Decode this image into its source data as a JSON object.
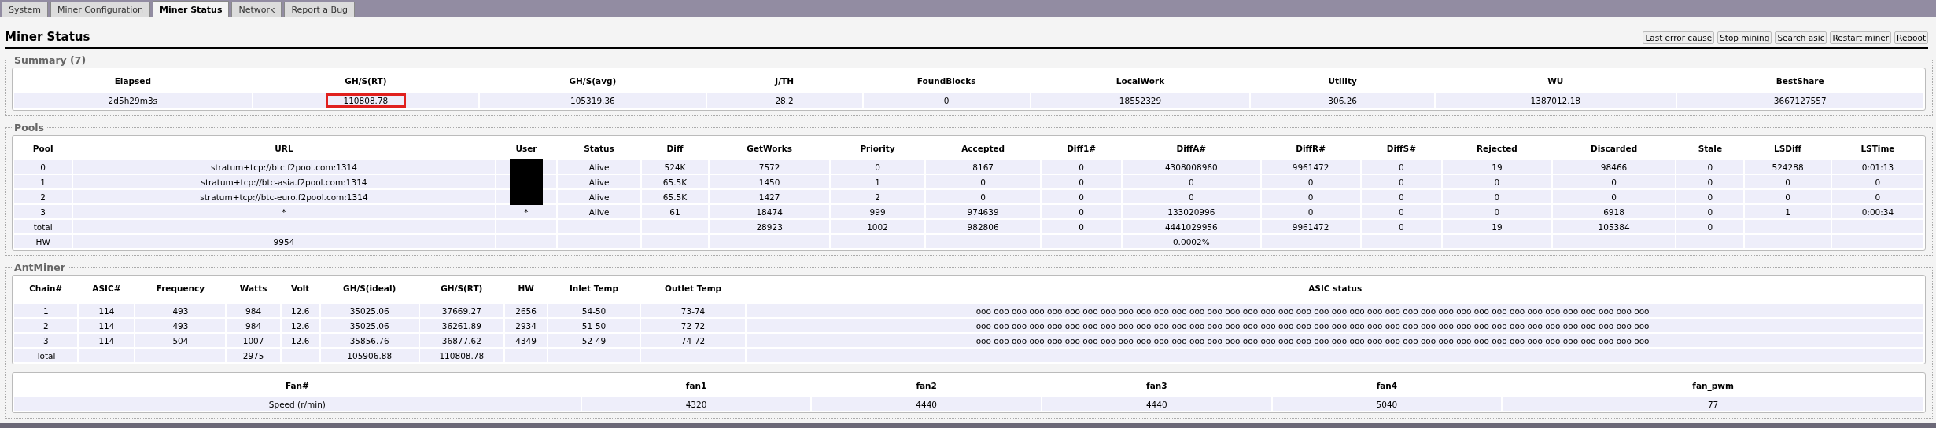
{
  "tabs": [
    {
      "label": "System",
      "selected": false
    },
    {
      "label": "Miner Configuration",
      "selected": false
    },
    {
      "label": "Miner Status",
      "selected": true
    },
    {
      "label": "Network",
      "selected": false
    },
    {
      "label": "Report a Bug",
      "selected": false
    }
  ],
  "page_title": "Miner Status",
  "buttons": [
    "Last error cause",
    "Stop mining",
    "Search asic",
    "Restart miner",
    "Reboot"
  ],
  "summary": {
    "title": "Summary (7)",
    "columns": [
      {
        "header": "Elapsed",
        "value": "2d5h29m3s",
        "highlighted": false
      },
      {
        "header": "GH/S(RT)",
        "value": "110808.78",
        "highlighted": true
      },
      {
        "header": "GH/S(avg)",
        "value": "105319.36",
        "highlighted": false
      },
      {
        "header": "J/TH",
        "value": "28.2",
        "highlighted": false
      },
      {
        "header": "FoundBlocks",
        "value": "0",
        "highlighted": false
      },
      {
        "header": "LocalWork",
        "value": "18552329",
        "highlighted": false
      },
      {
        "header": "Utility",
        "value": "306.26",
        "highlighted": false
      },
      {
        "header": "WU",
        "value": "1387012.18",
        "highlighted": false
      },
      {
        "header": "BestShare",
        "value": "3667127557",
        "highlighted": false
      }
    ]
  },
  "pools": {
    "title": "Pools",
    "columns": [
      "Pool",
      "URL",
      "User",
      "Status",
      "Diff",
      "GetWorks",
      "Priority",
      "Accepted",
      "Diff1#",
      "DiffA#",
      "DiffR#",
      "DiffS#",
      "Rejected",
      "Discarded",
      "Stale",
      "LSDiff",
      "LSTime"
    ],
    "rows": [
      [
        "0",
        "stratum+tcp://btc.f2pool.com:1314",
        {
          "redacted": true
        },
        "Alive",
        "524K",
        "7572",
        "0",
        "8167",
        "0",
        "4308008960",
        "9961472",
        "0",
        "19",
        "98466",
        "0",
        "524288",
        "0:01:13"
      ],
      [
        "1",
        "stratum+tcp://btc-asia.f2pool.com:1314",
        {
          "redacted": true
        },
        "Alive",
        "65.5K",
        "1450",
        "1",
        "0",
        "0",
        "0",
        "0",
        "0",
        "0",
        "0",
        "0",
        "0",
        "0"
      ],
      [
        "2",
        "stratum+tcp://btc-euro.f2pool.com:1314",
        {
          "redacted": true
        },
        "Alive",
        "65.5K",
        "1427",
        "2",
        "0",
        "0",
        "0",
        "0",
        "0",
        "0",
        "0",
        "0",
        "0",
        "0"
      ],
      [
        "3",
        "*",
        "*",
        "Alive",
        "61",
        "18474",
        "999",
        "974639",
        "0",
        "133020996",
        "0",
        "0",
        "0",
        "6918",
        "0",
        "1",
        "0:00:34"
      ],
      [
        "total",
        null,
        null,
        null,
        null,
        "28923",
        "1002",
        "982806",
        "0",
        "4441029956",
        "9961472",
        "0",
        "19",
        "105384",
        "0",
        null,
        null
      ],
      [
        "HW",
        "9954",
        null,
        null,
        null,
        null,
        null,
        null,
        null,
        "0.0002%",
        null,
        null,
        null,
        null,
        null,
        null,
        null
      ]
    ]
  },
  "antminer": {
    "title": "AntMiner",
    "columns": [
      "Chain#",
      "ASIC#",
      "Frequency",
      "Watts",
      "Volt",
      "GH/S(ideal)",
      "GH/S(RT)",
      "HW",
      "Inlet Temp",
      "Outlet Temp",
      "ASIC status"
    ],
    "rows": [
      [
        "1",
        "114",
        "493",
        "984",
        "12.6",
        "35025.06",
        "37669.27",
        "2656",
        "54-50",
        "73-74",
        "ooo ooo ooo ooo ooo ooo ooo ooo ooo ooo ooo ooo ooo ooo ooo ooo ooo ooo ooo ooo ooo ooo ooo ooo ooo ooo ooo ooo ooo ooo ooo ooo ooo ooo ooo ooo ooo ooo"
      ],
      [
        "2",
        "114",
        "493",
        "984",
        "12.6",
        "35025.06",
        "36261.89",
        "2934",
        "51-50",
        "72-72",
        "ooo ooo ooo ooo ooo ooo ooo ooo ooo ooo ooo ooo ooo ooo ooo ooo ooo ooo ooo ooo ooo ooo ooo ooo ooo ooo ooo ooo ooo ooo ooo ooo ooo ooo ooo ooo ooo ooo"
      ],
      [
        "3",
        "114",
        "504",
        "1007",
        "12.6",
        "35856.76",
        "36877.62",
        "4349",
        "52-49",
        "74-72",
        "ooo ooo ooo ooo ooo ooo ooo ooo ooo ooo ooo ooo ooo ooo ooo ooo ooo ooo ooo ooo ooo ooo ooo ooo ooo ooo ooo ooo ooo ooo ooo ooo ooo ooo ooo ooo ooo ooo"
      ],
      [
        "Total",
        null,
        null,
        "2975",
        null,
        "105906.88",
        "110808.78",
        null,
        null,
        null,
        null
      ]
    ],
    "fans": {
      "columns": [
        "Fan#",
        "fan1",
        "fan2",
        "fan3",
        "fan4",
        "fan_pwm"
      ],
      "values": [
        "Speed (r/min)",
        "4320",
        "4440",
        "4440",
        "5040",
        "77"
      ]
    }
  }
}
